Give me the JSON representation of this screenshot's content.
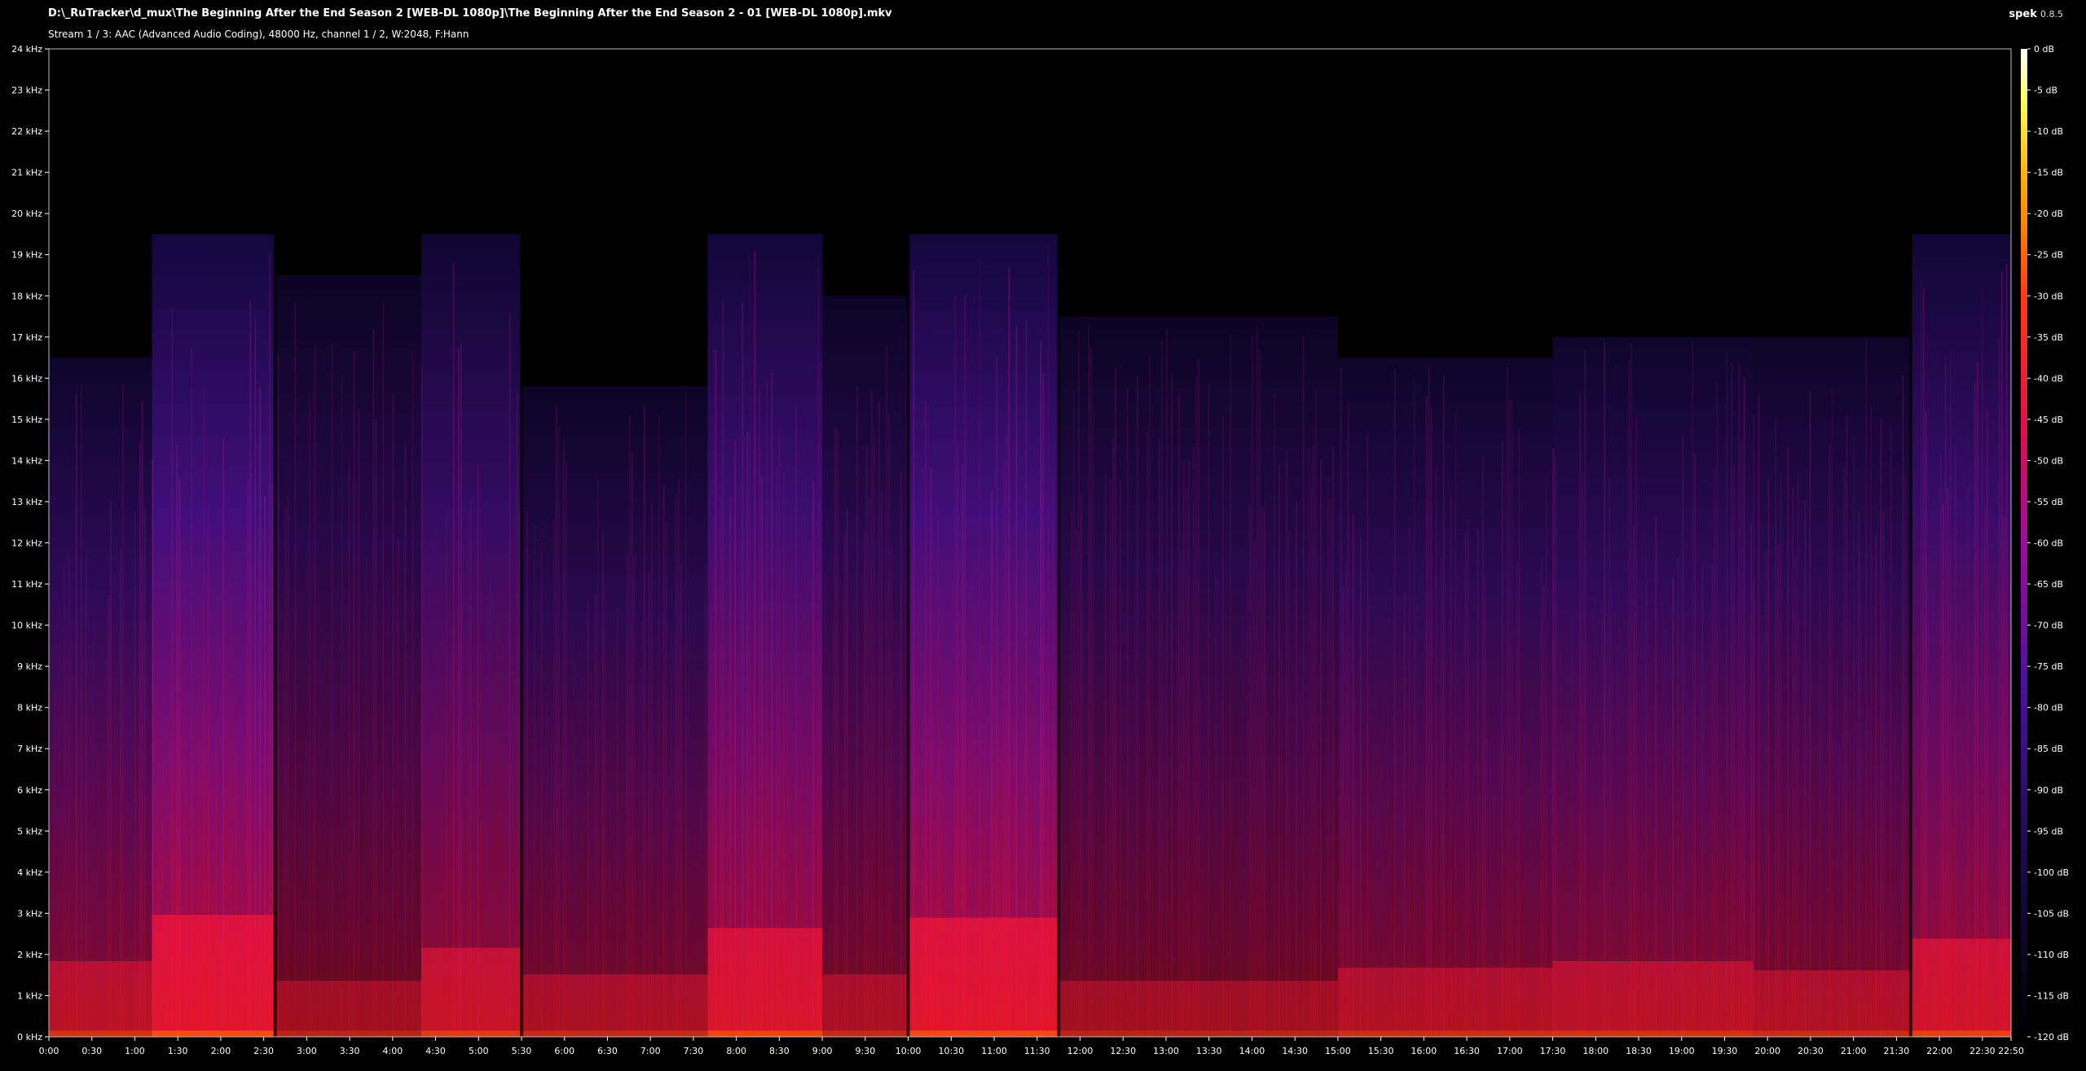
{
  "window": {
    "file_path": "D:\\_RuTracker\\d_mux\\The Beginning After the End Season 2 [WEB-DL 1080p]\\The Beginning After the End Season 2 - 01 [WEB-DL 1080p].mkv",
    "stream_info": "Stream 1 / 3: AAC (Advanced Audio Coding), 48000 Hz, channel 1 / 2, W:2048, F:Hann",
    "app_name": "spek",
    "app_version": "0.8.5"
  },
  "chart_data": {
    "type": "heatmap",
    "title": "",
    "xlabel": "",
    "ylabel": "",
    "x_ticks": [
      "0:00",
      "0:30",
      "1:00",
      "1:30",
      "2:00",
      "2:30",
      "3:00",
      "3:30",
      "4:00",
      "4:30",
      "5:00",
      "5:30",
      "6:00",
      "6:30",
      "7:00",
      "7:30",
      "8:00",
      "8:30",
      "9:00",
      "9:30",
      "10:00",
      "10:30",
      "11:00",
      "11:30",
      "12:00",
      "12:30",
      "13:00",
      "13:30",
      "14:00",
      "14:30",
      "15:00",
      "15:30",
      "16:00",
      "16:30",
      "17:00",
      "17:30",
      "18:00",
      "18:30",
      "19:00",
      "19:30",
      "20:00",
      "20:30",
      "21:00",
      "21:30",
      "22:00",
      "22:30",
      "22:50"
    ],
    "x_range_seconds": [
      0,
      1370
    ],
    "y_ticks": [
      "0 kHz",
      "1 kHz",
      "2 kHz",
      "3 kHz",
      "4 kHz",
      "5 kHz",
      "6 kHz",
      "7 kHz",
      "8 kHz",
      "9 kHz",
      "10 kHz",
      "11 kHz",
      "12 kHz",
      "13 kHz",
      "14 kHz",
      "15 kHz",
      "16 kHz",
      "17 kHz",
      "18 kHz",
      "19 kHz",
      "20 kHz",
      "21 kHz",
      "22 kHz",
      "23 kHz",
      "24 kHz"
    ],
    "y_range_khz": [
      0,
      24
    ],
    "colorbar_ticks": [
      "0 dB",
      "-5 dB",
      "-10 dB",
      "-15 dB",
      "-20 dB",
      "-25 dB",
      "-30 dB",
      "-35 dB",
      "-40 dB",
      "-45 dB",
      "-50 dB",
      "-55 dB",
      "-60 dB",
      "-65 dB",
      "-70 dB",
      "-75 dB",
      "-80 dB",
      "-85 dB",
      "-90 dB",
      "-95 dB",
      "-100 dB",
      "-105 dB",
      "-110 dB",
      "-115 dB",
      "-120 dB"
    ],
    "colorbar_range_db": [
      -120,
      0
    ],
    "frequency_cutoff_khz": 19.5,
    "segments": [
      {
        "start": 0,
        "end": 72,
        "level": 0.45,
        "cutoff_khz": 16.5
      },
      {
        "start": 72,
        "end": 158,
        "level": 0.8,
        "cutoff_khz": 19.5
      },
      {
        "start": 158,
        "end": 260,
        "level": 0.3,
        "cutoff_khz": 18.5
      },
      {
        "start": 260,
        "end": 330,
        "level": 0.55,
        "cutoff_khz": 19.5
      },
      {
        "start": 330,
        "end": 460,
        "level": 0.35,
        "cutoff_khz": 15.8
      },
      {
        "start": 460,
        "end": 540,
        "level": 0.7,
        "cutoff_khz": 19.5
      },
      {
        "start": 540,
        "end": 600,
        "level": 0.35,
        "cutoff_khz": 18.0
      },
      {
        "start": 600,
        "end": 705,
        "level": 0.78,
        "cutoff_khz": 19.5
      },
      {
        "start": 705,
        "end": 900,
        "level": 0.3,
        "cutoff_khz": 17.5
      },
      {
        "start": 900,
        "end": 1050,
        "level": 0.4,
        "cutoff_khz": 16.5
      },
      {
        "start": 1050,
        "end": 1190,
        "level": 0.45,
        "cutoff_khz": 17.0
      },
      {
        "start": 1190,
        "end": 1300,
        "level": 0.38,
        "cutoff_khz": 17.0
      },
      {
        "start": 1300,
        "end": 1370,
        "level": 0.62,
        "cutoff_khz": 19.5
      }
    ]
  }
}
